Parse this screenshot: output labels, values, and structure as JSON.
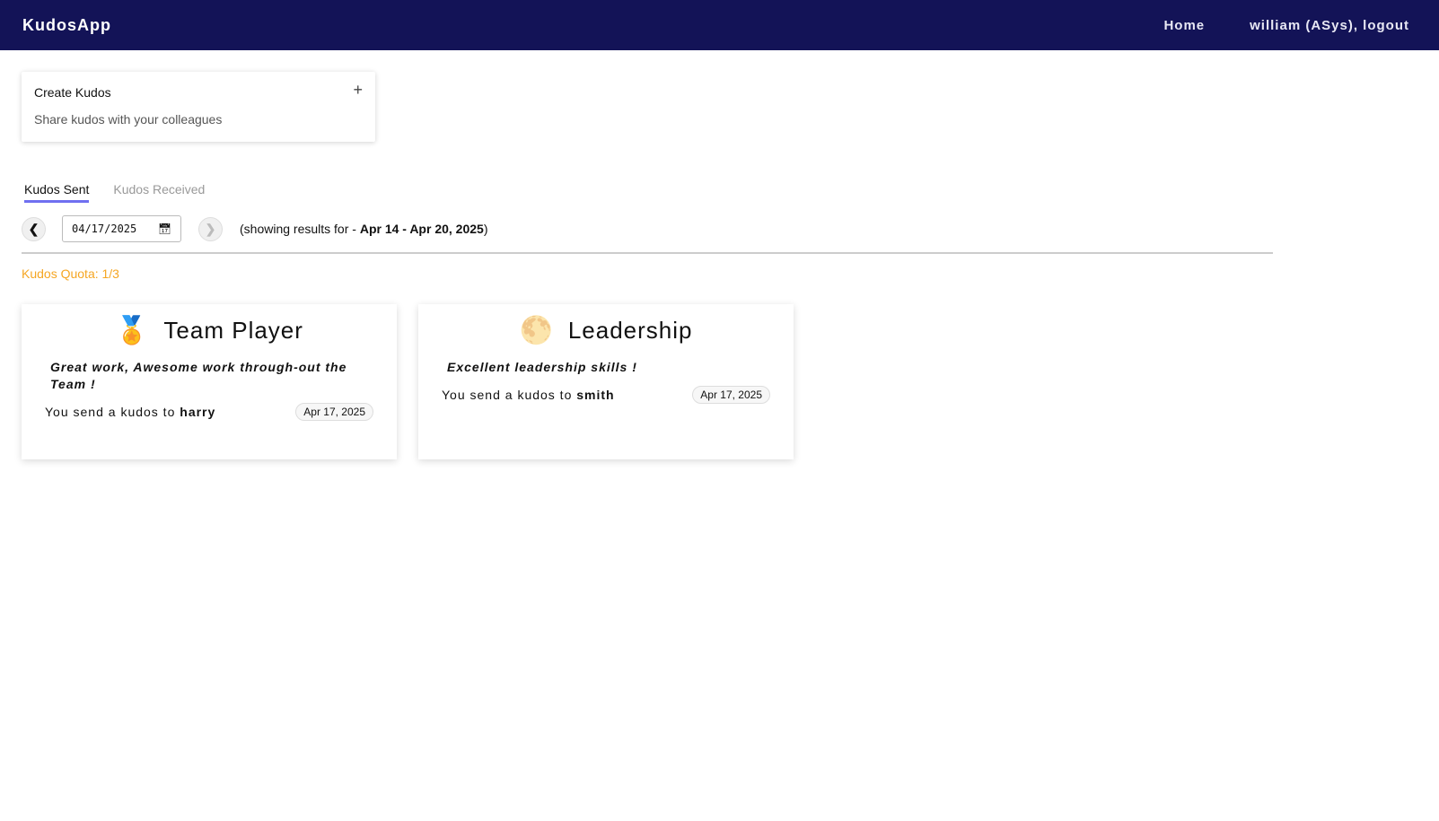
{
  "nav": {
    "brand": "KudosApp",
    "home": "Home",
    "user": "william (ASys), logout"
  },
  "create": {
    "title": "Create Kudos",
    "subtitle": "Share kudos with your colleagues",
    "plus": "+"
  },
  "tabs": [
    {
      "label": "Kudos Sent",
      "active": true
    },
    {
      "label": "Kudos Received",
      "active": false
    }
  ],
  "date": {
    "value": "04/17/2025",
    "prefix": "(showing results for - ",
    "range": "Apr 14 - Apr 20, 2025",
    "suffix": ")"
  },
  "quota": "Kudos Quota: 1/3",
  "cards": [
    {
      "emoji": "🏅",
      "title": "Team Player",
      "message": "Great work, Awesome work through-out the Team !",
      "prefix": "You send a kudos to ",
      "recipient": "harry",
      "date": "Apr 17, 2025"
    },
    {
      "emoji": "🌕",
      "title": "Leadership",
      "message": "Excellent leadership skills !",
      "prefix": "You send a kudos to ",
      "recipient": "smith",
      "date": "Apr 17, 2025"
    }
  ],
  "colors": {
    "nav": "#131357",
    "accent": "#7070f0",
    "quota": "#f5a623"
  }
}
